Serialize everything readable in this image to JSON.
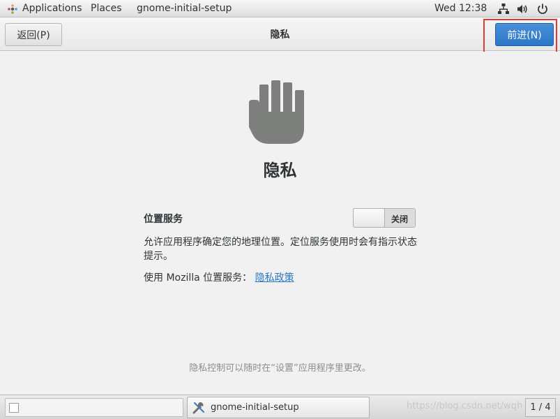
{
  "topbar": {
    "applications": "Applications",
    "places": "Places",
    "window_title": "gnome-initial-setup",
    "clock": "Wed 12:38",
    "icons": [
      "network-icon",
      "volume-icon",
      "power-icon"
    ]
  },
  "header": {
    "back_label": "返回(P)",
    "title": "隐私",
    "next_label": "前进(N)"
  },
  "main": {
    "hero_icon": "hand-icon",
    "heading": "隐私",
    "location_services": {
      "label": "位置服务",
      "switch_state": "关闭",
      "enabled": false
    },
    "description": "允许应用程序确定您的地理位置。定位服务使用时会有指示状态提示。",
    "policy_prefix": "使用 Mozilla 位置服务：",
    "policy_link": "隐私政策",
    "footnote": "隐私控制可以随时在“设置”应用程序里更改。"
  },
  "taskbar": {
    "task_label": "gnome-initial-setup",
    "watermark": "https://blog.csdn.net/wqh",
    "pager": "1 / 4"
  },
  "colors": {
    "accent": "#2a76c6",
    "highlight": "#e53935"
  }
}
